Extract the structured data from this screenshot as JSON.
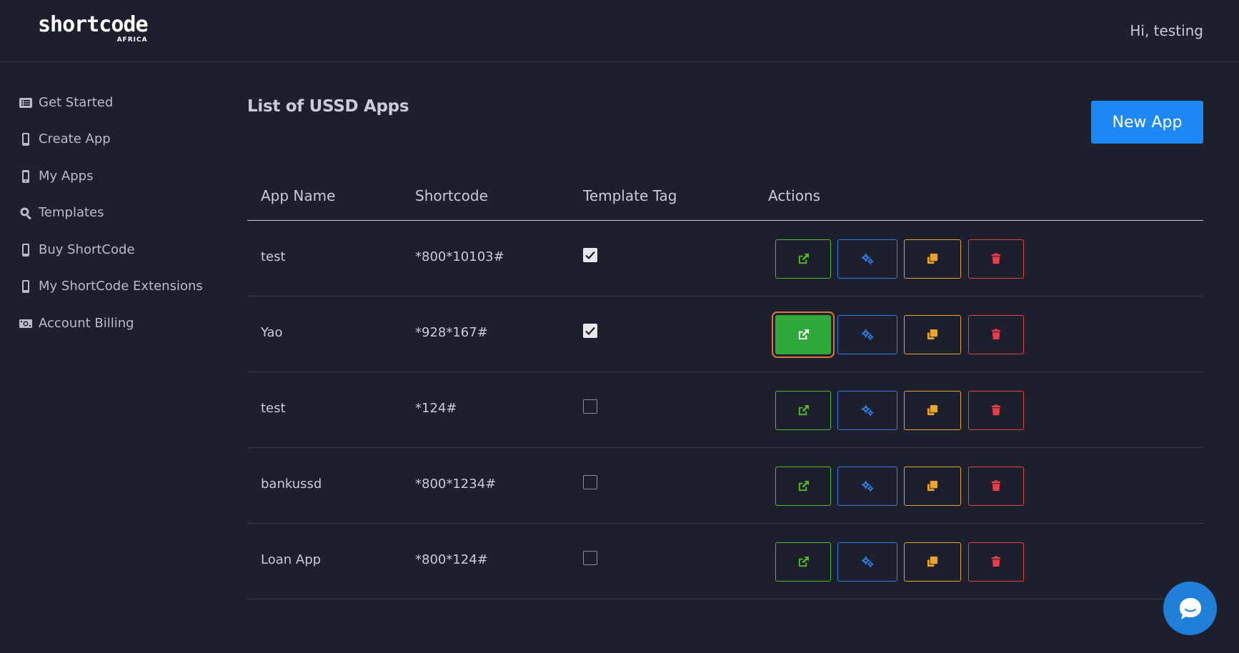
{
  "brand": {
    "name": "shortcode",
    "sub": "AFRICA"
  },
  "header": {
    "greeting": "Hi, testing"
  },
  "sidebar": {
    "items": [
      {
        "label": "Get Started",
        "icon": "list-icon"
      },
      {
        "label": "Create App",
        "icon": "mobile-icon"
      },
      {
        "label": "My Apps",
        "icon": "mobile-alt-icon"
      },
      {
        "label": "Templates",
        "icon": "search-icon"
      },
      {
        "label": "Buy ShortCode",
        "icon": "mobile-icon"
      },
      {
        "label": "My ShortCode Extensions",
        "icon": "mobile-icon"
      },
      {
        "label": "Account Billing",
        "icon": "money-bill-icon"
      }
    ]
  },
  "main": {
    "title": "List of USSD Apps",
    "new_app_label": "New App",
    "columns": [
      "App Name",
      "Shortcode",
      "Template Tag",
      "Actions"
    ],
    "rows": [
      {
        "name": "test",
        "shortcode": "*800*10103#",
        "template": true
      },
      {
        "name": "Yao",
        "shortcode": "*928*167#",
        "template": true
      },
      {
        "name": "test",
        "shortcode": "*124#",
        "template": false
      },
      {
        "name": "bankussd",
        "shortcode": "*800*1234#",
        "template": false
      },
      {
        "name": "Loan App",
        "shortcode": "*800*124#",
        "template": false
      }
    ],
    "actions": [
      "external-link-icon",
      "cogs-icon",
      "copy-icon",
      "trash-icon"
    ]
  },
  "colors": {
    "background": "#1e1f2c",
    "primary": "#1e88f5",
    "open": "#57b82a",
    "settings": "#2f7ee6",
    "copy": "#eaa42e",
    "delete": "#ef3b47",
    "focus_ring": "#e0703c"
  }
}
